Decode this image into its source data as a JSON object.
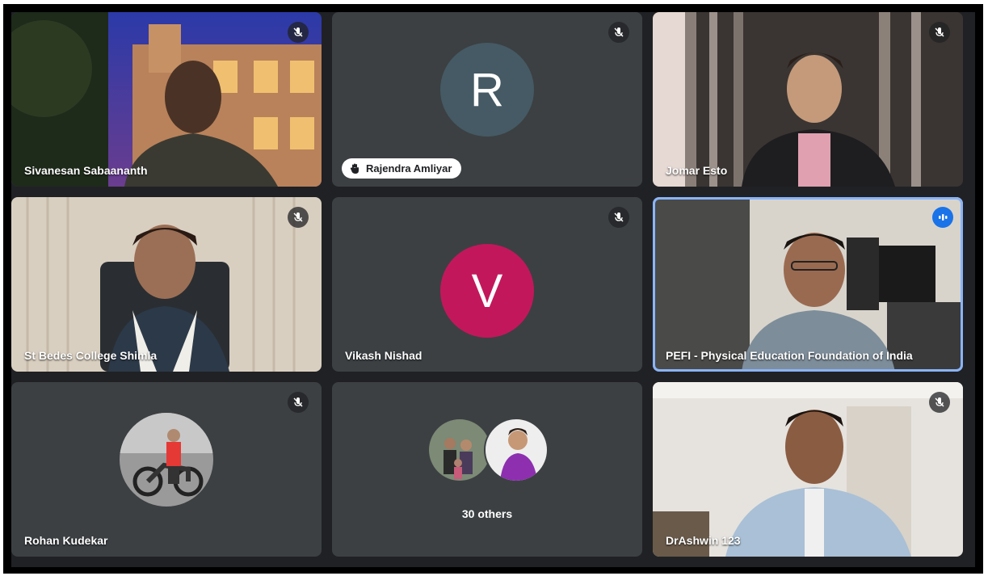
{
  "participants": [
    {
      "name": "Sivanesan Sabaananth",
      "muted": true
    },
    {
      "name": "Rajendra Amliyar",
      "muted": true,
      "avatar_letter": "R",
      "avatar_color": "#455a64"
    },
    {
      "name": "Jomar Esto",
      "muted": true
    },
    {
      "name": "St Bedes College Shimla",
      "muted": true
    },
    {
      "name": "Vikash Nishad",
      "muted": true,
      "avatar_letter": "V",
      "avatar_color": "#c2185b"
    },
    {
      "name": "PEFI - Physical Education Foundation of India",
      "muted": false,
      "speaking": true
    },
    {
      "name": "Rohan Kudekar",
      "muted": true
    },
    {
      "name": "DrAshwin 123",
      "muted": true
    }
  ],
  "others": {
    "label": "30 others"
  },
  "colors": {
    "accent": "#1a73e8",
    "active_border": "#8ab4f8",
    "tile_bg": "#3c4043",
    "stage_bg": "#202124"
  },
  "icons": {
    "mute": "mic-off-icon",
    "speaking": "audio-level-icon",
    "hand": "hand-icon"
  }
}
